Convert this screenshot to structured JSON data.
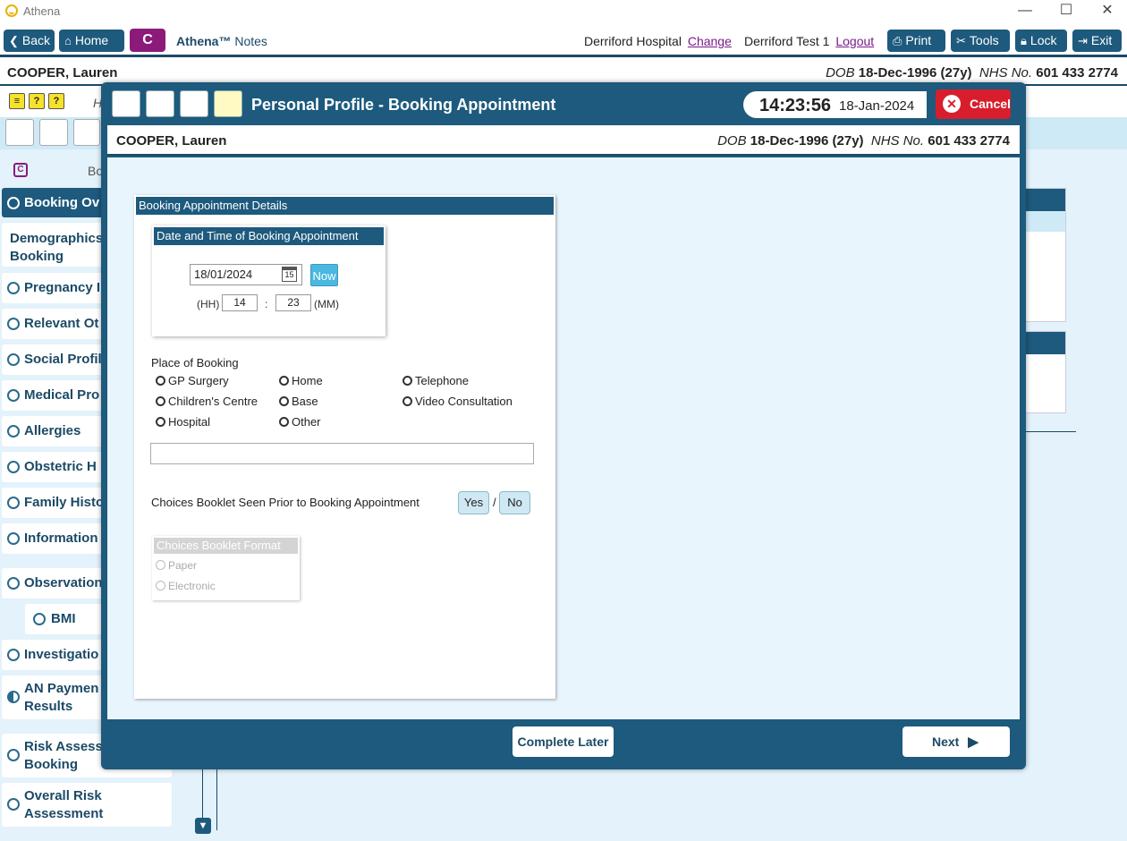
{
  "window": {
    "title": "Athena",
    "minimize": "—",
    "maximize": "☐",
    "close": "✕"
  },
  "toolbar": {
    "back": "Back",
    "home": "Home",
    "c_button": "C",
    "brand_name": "Athena™",
    "brand_suffix": "Notes",
    "hospital": "Derriford Hospital",
    "change": "Change",
    "user": "Derriford Test 1",
    "logout": "Logout",
    "print": "Print",
    "tools": "Tools",
    "lock": "Lock",
    "exit": "Exit"
  },
  "patient": {
    "name": "COOPER, Lauren",
    "dob_label": "DOB",
    "dob": "18-Dec-1996 (27y)",
    "nhs_label": "NHS No.",
    "nhs": "601 433 2774"
  },
  "background": {
    "header_h": "H",
    "section_initial": "Bo",
    "sidebar": [
      {
        "label": "Booking Ov"
      },
      {
        "label": "Demographics Booking"
      },
      {
        "label": "Pregnancy I"
      },
      {
        "label": "Relevant Ot"
      },
      {
        "label": "Social Profil"
      },
      {
        "label": "Medical Pro"
      },
      {
        "label": "Allergies"
      },
      {
        "label": "Obstetric H"
      },
      {
        "label": "Family Histo"
      },
      {
        "label": "Information"
      },
      {
        "label": "Observation"
      },
      {
        "label": "BMI"
      },
      {
        "label": "Investigatio"
      },
      {
        "label": "AN Paymen Results"
      },
      {
        "label": "Risk Assess Booking"
      },
      {
        "label": "Overall Risk Assessment"
      }
    ]
  },
  "modal": {
    "title": "Personal Profile - Booking Appointment",
    "time": "14:23:56",
    "date": "18-Jan-2024",
    "cancel": "Cancel",
    "panel_title": "Booking Appointment Details",
    "dt_title": "Date and Time of Booking Appointment",
    "date_value": "18/01/2024",
    "cal_day": "15",
    "now": "Now",
    "hh_label": "(HH)",
    "hh_value": "14",
    "colon": ":",
    "mm_value": "23",
    "mm_label": "(MM)",
    "place_label": "Place of Booking",
    "places": {
      "gp": "GP Surgery",
      "home": "Home",
      "telephone": "Telephone",
      "children": "Children's Centre",
      "base": "Base",
      "video": "Video Consultation",
      "hospital": "Hospital",
      "other": "Other"
    },
    "place_other_value": "",
    "choices_label": "Choices Booklet Seen Prior to Booking Appointment",
    "yes": "Yes",
    "slash": "/",
    "no": "No",
    "format_title": "Choices Booklet Format",
    "format_paper": "Paper",
    "format_electronic": "Electronic",
    "complete_later": "Complete Later",
    "next": "Next"
  },
  "colors": {
    "primary": "#1d5a7d",
    "brand": "#8b1a7a",
    "cancel": "#d81e2c",
    "now": "#4ab8e0"
  }
}
